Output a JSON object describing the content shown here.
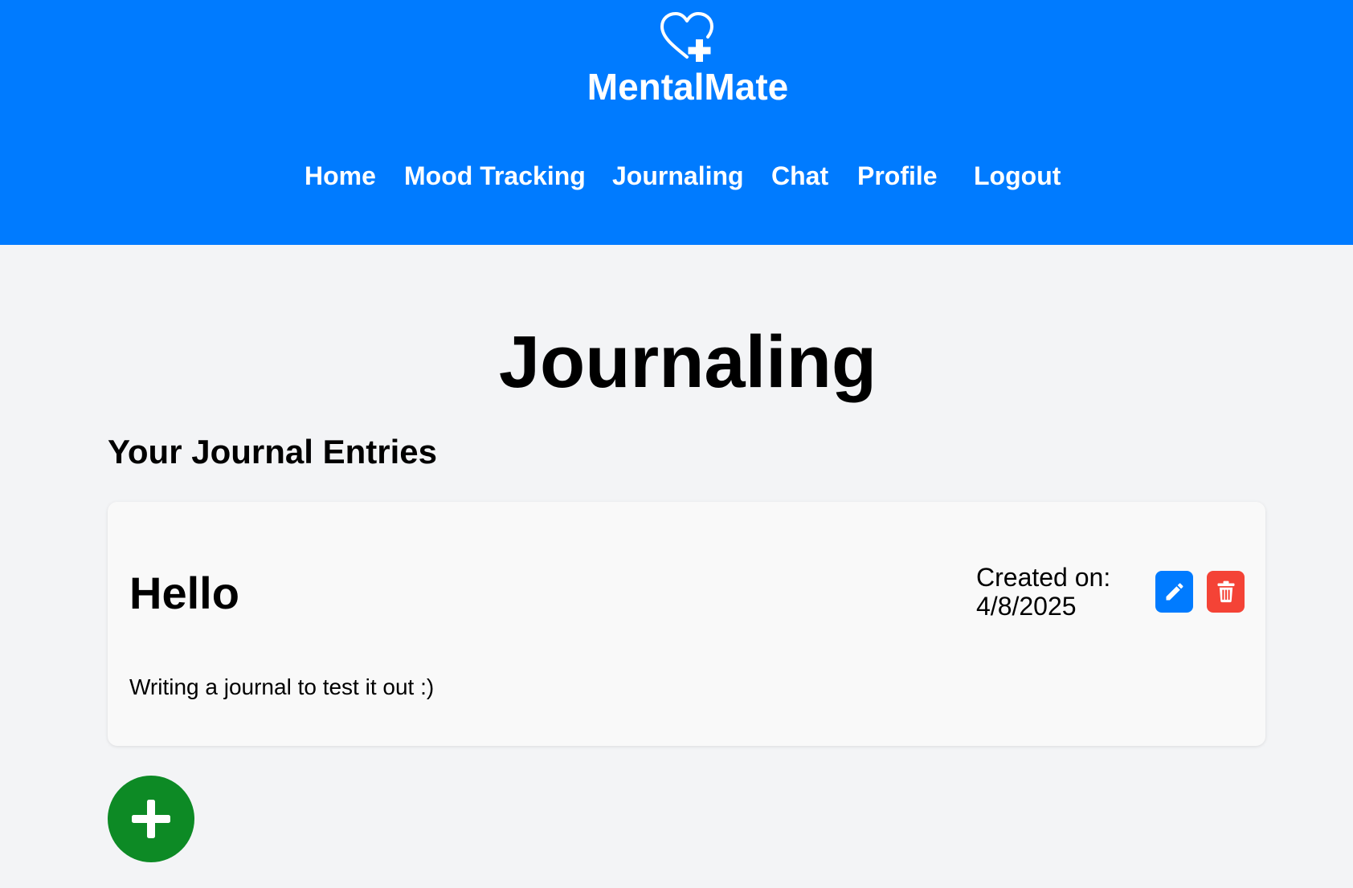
{
  "header": {
    "brand": "MentalMate",
    "logo_icon": "heart-plus-icon",
    "nav": [
      {
        "label": "Home"
      },
      {
        "label": "Mood Tracking"
      },
      {
        "label": "Journaling"
      },
      {
        "label": "Chat"
      },
      {
        "label": "Profile"
      },
      {
        "label": "Logout"
      }
    ]
  },
  "main": {
    "title": "Journaling",
    "section_title": "Your Journal Entries",
    "entries": [
      {
        "title": "Hello",
        "created_label": "Created on:",
        "created_date": "4/8/2025",
        "body": "Writing a journal to test it out :)",
        "edit_icon": "pencil-icon",
        "delete_icon": "trash-icon"
      }
    ],
    "add_icon": "plus-icon"
  },
  "colors": {
    "header_bg": "#007bff",
    "page_bg": "#f3f4f6",
    "edit_button": "#007bff",
    "delete_button": "#f44336",
    "add_button": "#0d8a25"
  }
}
